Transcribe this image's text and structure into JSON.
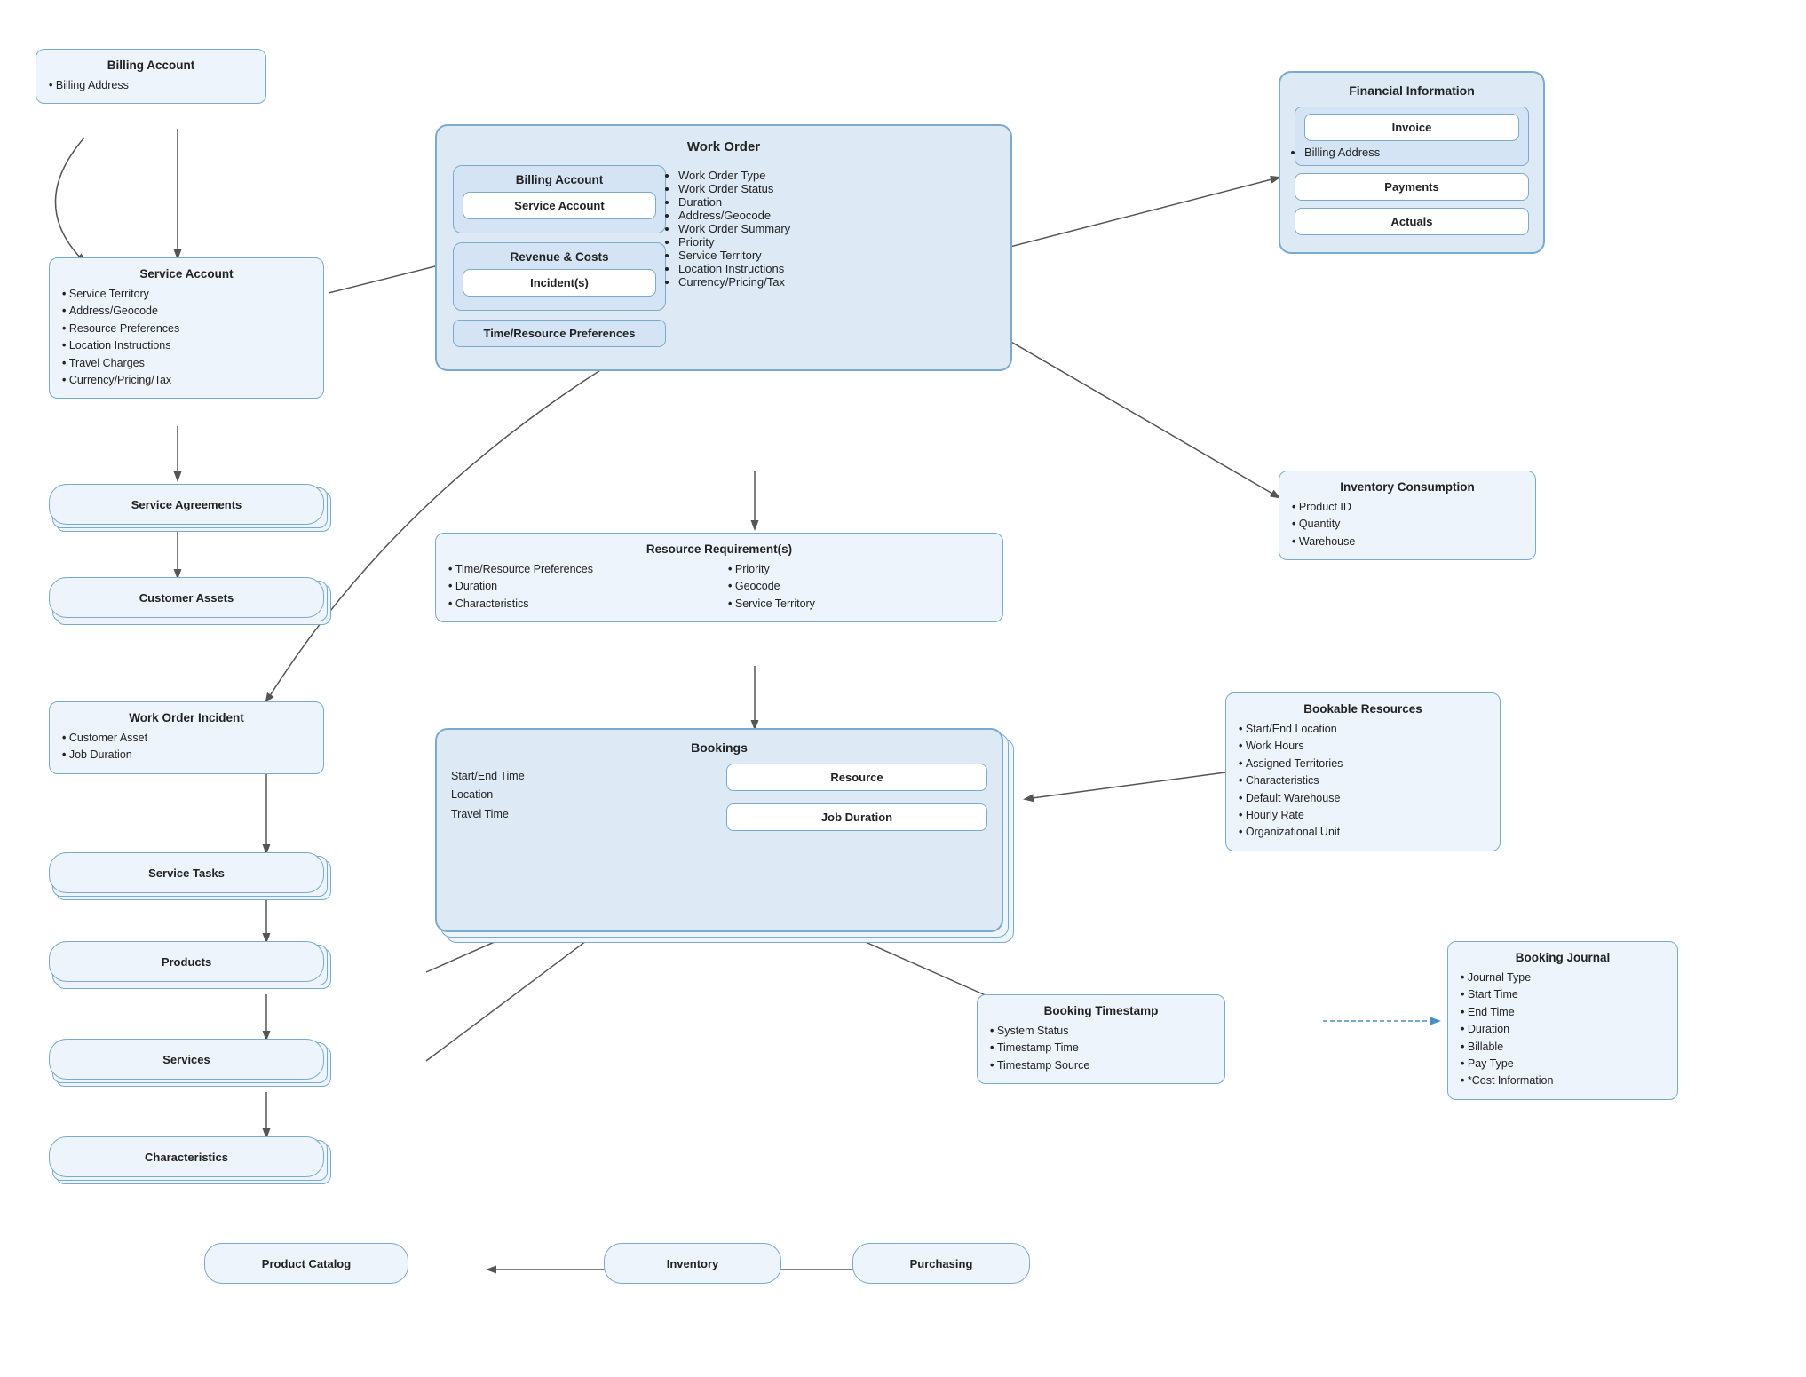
{
  "billingAccountTop": {
    "title": "Billing Account",
    "items": [
      "Billing Address"
    ]
  },
  "serviceAccount": {
    "title": "Service Account",
    "items": [
      "Service Territory",
      "Address/Geocode",
      "Resource Preferences",
      "Location Instructions",
      "Travel Charges",
      "Currency/Pricing/Tax"
    ]
  },
  "serviceAgreements": {
    "label": "Service Agreements"
  },
  "customerAssets": {
    "label": "Customer Assets"
  },
  "workOrderIncident": {
    "title": "Work Order Incident",
    "items": [
      "Customer Asset",
      "Job Duration"
    ]
  },
  "serviceTasks": {
    "label": "Service Tasks"
  },
  "products": {
    "label": "Products"
  },
  "services": {
    "label": "Services"
  },
  "characteristics": {
    "label": "Characteristics"
  },
  "productCatalog": {
    "label": "Product Catalog"
  },
  "inventory": {
    "label": "Inventory"
  },
  "purchasing": {
    "label": "Purchasing"
  },
  "workOrder": {
    "title": "Work Order",
    "billingAccount": "Billing Account",
    "serviceAccount": "Service Account",
    "revenueCosts": "Revenue & Costs",
    "incidents": "Incident(s)",
    "timeResourcePrefs": "Time/Resource Preferences",
    "items": [
      "Work Order Type",
      "Work Order Status",
      "Duration",
      "Address/Geocode",
      "Work Order Summary",
      "Priority",
      "Service Territory",
      "Location Instructions",
      "Currency/Pricing/Tax"
    ]
  },
  "financialInfo": {
    "title": "Financial Information",
    "invoice": "Invoice",
    "invoiceItems": [
      "Billing Address"
    ],
    "payments": "Payments",
    "actuals": "Actuals"
  },
  "inventoryConsumption": {
    "title": "Inventory Consumption",
    "items": [
      "Product ID",
      "Quantity",
      "Warehouse"
    ]
  },
  "resourceRequirements": {
    "title": "Resource Requirement(s)",
    "col1": [
      "Time/Resource Preferences",
      "Duration",
      "Characteristics"
    ],
    "col2": [
      "Priority",
      "Geocode",
      "Service Territory"
    ]
  },
  "bookings": {
    "title": "Bookings",
    "leftItems": [
      "Start/End Time",
      "Location",
      "Travel Time"
    ],
    "resource": "Resource",
    "jobDuration": "Job Duration"
  },
  "bookableResources": {
    "title": "Bookable Resources",
    "items": [
      "Start/End Location",
      "Work Hours",
      "Assigned Territories",
      "Characteristics",
      "Default Warehouse",
      "Hourly Rate",
      "Organizational Unit"
    ]
  },
  "bookingTimestamp": {
    "title": "Booking Timestamp",
    "items": [
      "System Status",
      "Timestamp Time",
      "Timestamp Source"
    ]
  },
  "bookingJournal": {
    "title": "Booking Journal",
    "items": [
      "Journal Type",
      "Start Time",
      "End Time",
      "Duration",
      "Billable",
      "Pay Type",
      "*Cost Information"
    ]
  }
}
